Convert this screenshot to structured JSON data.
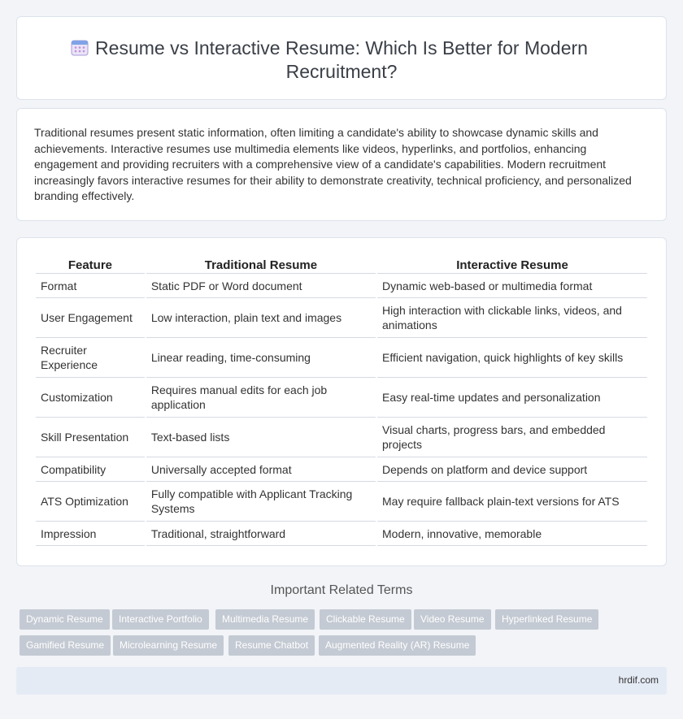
{
  "header": {
    "icon": "calendar-icon",
    "title": "Resume vs Interactive Resume: Which Is Better for Modern Recruitment?"
  },
  "summary": "Traditional resumes present static information, often limiting a candidate's ability to showcase dynamic skills and achievements. Interactive resumes use multimedia elements like videos, hyperlinks, and portfolios, enhancing engagement and providing recruiters with a comprehensive view of a candidate's capabilities. Modern recruitment increasingly favors interactive resumes for their ability to demonstrate creativity, technical proficiency, and personalized branding effectively.",
  "table": {
    "headers": [
      "Feature",
      "Traditional Resume",
      "Interactive Resume"
    ],
    "rows": [
      [
        "Format",
        "Static PDF or Word document",
        "Dynamic web-based or multimedia format"
      ],
      [
        "User Engagement",
        "Low interaction, plain text and images",
        "High interaction with clickable links, videos, and animations"
      ],
      [
        "Recruiter Experience",
        "Linear reading, time-consuming",
        "Efficient navigation, quick highlights of key skills"
      ],
      [
        "Customization",
        "Requires manual edits for each job application",
        "Easy real-time updates and personalization"
      ],
      [
        "Skill Presentation",
        "Text-based lists",
        "Visual charts, progress bars, and embedded projects"
      ],
      [
        "Compatibility",
        "Universally accepted format",
        "Depends on platform and device support"
      ],
      [
        "ATS Optimization",
        "Fully compatible with Applicant Tracking Systems",
        "May require fallback plain-text versions for ATS"
      ],
      [
        "Impression",
        "Traditional, straightforward",
        "Modern, innovative, memorable"
      ]
    ]
  },
  "related": {
    "title": "Important Related Terms",
    "tags": [
      "Dynamic Resume",
      "Interactive Portfolio",
      "Multimedia Resume",
      "Clickable Resume",
      "Video Resume",
      "Hyperlinked Resume",
      "Gamified Resume",
      "Microlearning Resume",
      "Resume Chatbot",
      "Augmented Reality (AR) Resume"
    ]
  },
  "footer": {
    "site": "hrdif.com"
  },
  "colors": {
    "tag_bg": "#c4cad3",
    "footer_bg": "#e5ebf5",
    "page_bg": "#f2f4f8"
  }
}
